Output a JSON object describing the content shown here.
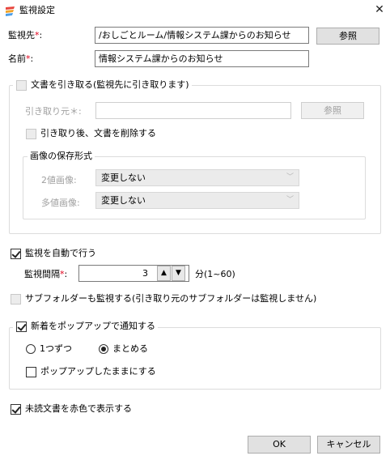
{
  "window": {
    "title": "監視設定",
    "close_glyph": "✕"
  },
  "form": {
    "watch_target": {
      "label": "監視先",
      "required_mark": "*",
      "colon": ":",
      "value": "/おしごとルーム/情報システム課からのお知らせ",
      "browse_label": "参照"
    },
    "name": {
      "label": "名前",
      "required_mark": "*",
      "colon": ":",
      "value": "情報システム課からのお知らせ"
    }
  },
  "fetch_group": {
    "checkbox_label": "文書を引き取る(監視先に引き取ります)",
    "source": {
      "label": "引き取り元＊:",
      "value": "",
      "browse_label": "参照"
    },
    "delete_after": "引き取り後、文書を削除する",
    "image_group": {
      "title": "画像の保存形式",
      "binary": {
        "label": "2値画像:",
        "value": "変更しない"
      },
      "multi": {
        "label": "多値画像:",
        "value": "変更しない"
      }
    }
  },
  "auto_watch": {
    "label": "監視を自動で行う",
    "interval": {
      "label": "監視間隔",
      "required_mark": "*",
      "colon": ":",
      "value": "3",
      "unit": "分(1~60)"
    }
  },
  "subfolder": {
    "label": "サブフォルダーも監視する(引き取り元のサブフォルダーは監視しません)"
  },
  "popup_group": {
    "title": "新着をポップアップで通知する",
    "one_by_one": "1つずつ",
    "together": "まとめる",
    "keep_popup": "ポップアップしたままにする"
  },
  "unread_red": {
    "label": "未読文書を赤色で表示する"
  },
  "buttons": {
    "ok": "OK",
    "cancel": "キャンセル"
  },
  "colors": {
    "required": "#e0001b",
    "disabled_text": "#a0a0a0"
  }
}
